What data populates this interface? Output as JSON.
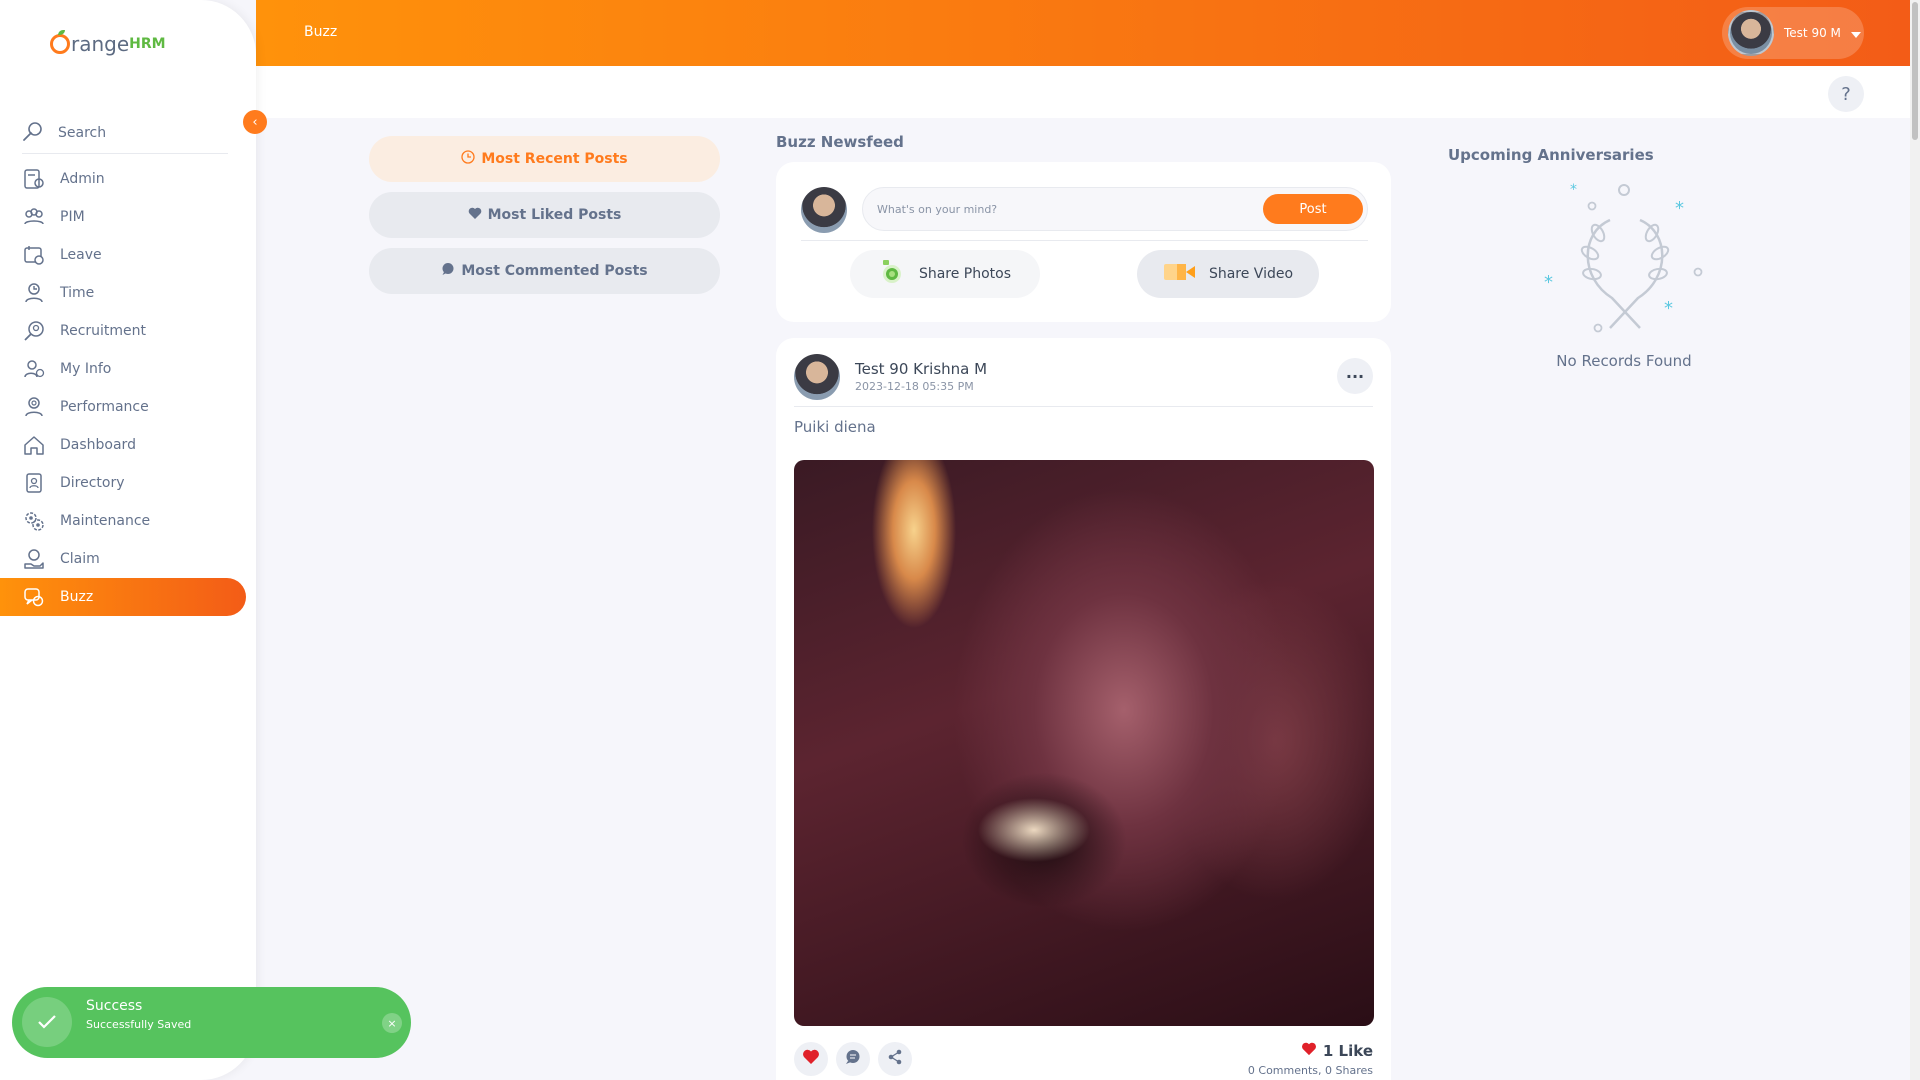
{
  "app": {
    "logo_text": "range",
    "logo_suffix": "HRM"
  },
  "topbar": {
    "title": "Buzz",
    "user_name": "Test 90 M"
  },
  "help_label": "?",
  "sidebar": {
    "search_label": "Search",
    "items": [
      {
        "label": "Admin",
        "icon": "admin-icon"
      },
      {
        "label": "PIM",
        "icon": "pim-icon"
      },
      {
        "label": "Leave",
        "icon": "leave-icon"
      },
      {
        "label": "Time",
        "icon": "time-icon"
      },
      {
        "label": "Recruitment",
        "icon": "recruitment-icon"
      },
      {
        "label": "My Info",
        "icon": "my-info-icon"
      },
      {
        "label": "Performance",
        "icon": "performance-icon"
      },
      {
        "label": "Dashboard",
        "icon": "dashboard-icon"
      },
      {
        "label": "Directory",
        "icon": "directory-icon"
      },
      {
        "label": "Maintenance",
        "icon": "maintenance-icon"
      },
      {
        "label": "Claim",
        "icon": "claim-icon"
      },
      {
        "label": "Buzz",
        "icon": "buzz-icon",
        "active": true
      }
    ]
  },
  "filters": {
    "most_recent": "Most Recent Posts",
    "most_liked": "Most Liked Posts",
    "most_commented": "Most Commented Posts"
  },
  "feed": {
    "title": "Buzz Newsfeed",
    "composer_placeholder": "What's on your mind?",
    "post_button": "Post",
    "share_photos": "Share Photos",
    "share_video": "Share Video"
  },
  "post": {
    "author": "Test 90 Krishna M",
    "timestamp": "2023-12-18 05:35 PM",
    "text": "Puiki diena",
    "likes": "1 Like",
    "comments": "0 Comments",
    "shares": "0 Shares",
    "more_label": "···"
  },
  "anniversaries": {
    "title": "Upcoming Anniversaries",
    "empty": "No Records Found"
  },
  "toast": {
    "title": "Success",
    "message": "Successfully Saved",
    "close": "×"
  },
  "colors": {
    "brand_orange": "#ff7b1d",
    "success_green": "#56c35e",
    "heart_red": "#e0212a"
  }
}
